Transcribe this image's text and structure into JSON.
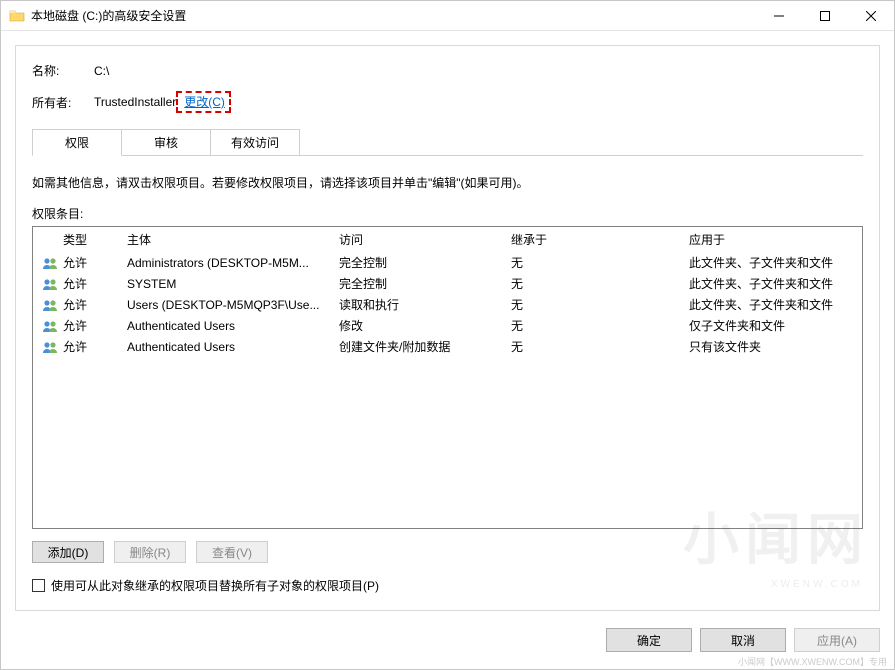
{
  "window": {
    "title": "本地磁盘 (C:)的高级安全设置"
  },
  "header": {
    "name_label": "名称:",
    "name_value": "C:\\",
    "owner_label": "所有者:",
    "owner_value": "TrustedInstaller",
    "change_link": "更改(C)"
  },
  "tabs": {
    "items": [
      {
        "label": "权限",
        "active": true
      },
      {
        "label": "审核",
        "active": false
      },
      {
        "label": "有效访问",
        "active": false
      }
    ]
  },
  "description": "如需其他信息，请双击权限项目。若要修改权限项目，请选择该项目并单击\"编辑\"(如果可用)。",
  "list_label": "权限条目:",
  "columns": {
    "type": "类型",
    "principal": "主体",
    "access": "访问",
    "inherit": "继承于",
    "applies": "应用于"
  },
  "entries": [
    {
      "type": "允许",
      "principal": "Administrators (DESKTOP-M5M...",
      "access": "完全控制",
      "inherit": "无",
      "applies": "此文件夹、子文件夹和文件"
    },
    {
      "type": "允许",
      "principal": "SYSTEM",
      "access": "完全控制",
      "inherit": "无",
      "applies": "此文件夹、子文件夹和文件"
    },
    {
      "type": "允许",
      "principal": "Users (DESKTOP-M5MQP3F\\Use...",
      "access": "读取和执行",
      "inherit": "无",
      "applies": "此文件夹、子文件夹和文件"
    },
    {
      "type": "允许",
      "principal": "Authenticated Users",
      "access": "修改",
      "inherit": "无",
      "applies": "仅子文件夹和文件"
    },
    {
      "type": "允许",
      "principal": "Authenticated Users",
      "access": "创建文件夹/附加数据",
      "inherit": "无",
      "applies": "只有该文件夹"
    }
  ],
  "buttons": {
    "add": "添加(D)",
    "remove": "删除(R)",
    "view": "查看(V)"
  },
  "checkbox": {
    "label": "使用可从此对象继承的权限项目替换所有子对象的权限项目(P)"
  },
  "footer": {
    "ok": "确定",
    "cancel": "取消",
    "apply": "应用(A)"
  },
  "watermark": {
    "main": "小闻网",
    "sub": "XWENW.COM",
    "bottom": "小闻网【WWW.XWENW.COM】专用"
  }
}
